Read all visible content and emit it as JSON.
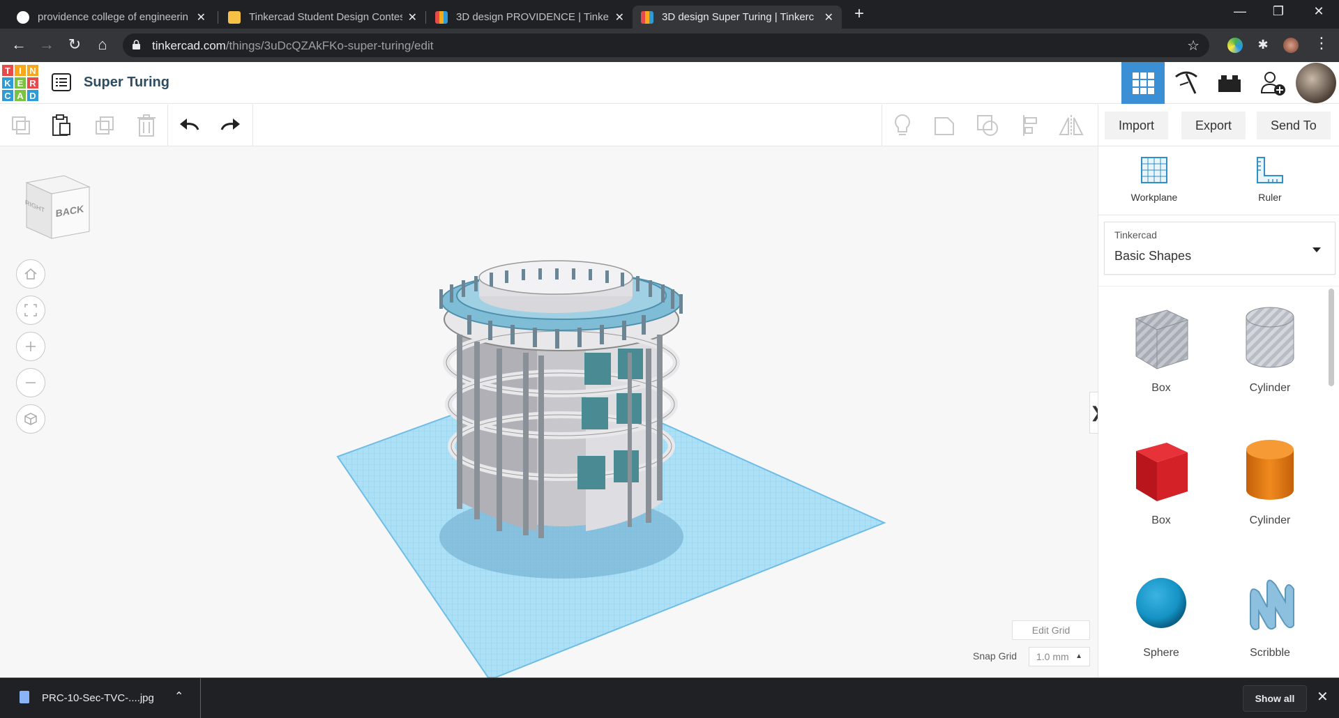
{
  "browser": {
    "tabs": [
      {
        "title": "providence college of engineerin",
        "active": false
      },
      {
        "title": "Tinkercad Student Design Contes",
        "active": false
      },
      {
        "title": "3D design PROVIDENCE | Tinkerc",
        "active": false
      },
      {
        "title": "3D design Super Turing | Tinkerc",
        "active": true
      }
    ],
    "url_host": "tinkercad.com",
    "url_path": "/things/3uDcQZAkFKo-super-turing/edit"
  },
  "app": {
    "logo_letters": [
      "T",
      "I",
      "N",
      "K",
      "E",
      "R",
      "C",
      "A",
      "D"
    ],
    "design_title": "Super Turing"
  },
  "toolbar": {
    "import_label": "Import",
    "export_label": "Export",
    "send_to_label": "Send To"
  },
  "workspace": {
    "viewcube_face": "BACK",
    "viewcube_side": "RIGHT",
    "edit_grid_label": "Edit Grid",
    "snap_grid_label": "Snap Grid",
    "snap_grid_value": "1.0 mm"
  },
  "panel": {
    "workplane_label": "Workplane",
    "ruler_label": "Ruler",
    "library_source": "Tinkercad",
    "library_name": "Basic Shapes",
    "shapes": [
      {
        "label": "Box",
        "color": "#b8bcc4"
      },
      {
        "label": "Cylinder",
        "color": "#c8ccd2"
      },
      {
        "label": "Box",
        "color": "#d42128"
      },
      {
        "label": "Cylinder",
        "color": "#e27b13"
      },
      {
        "label": "Sphere",
        "color": "#1593c4"
      },
      {
        "label": "Scribble",
        "color": "#7fb4d6"
      }
    ]
  },
  "downloads": {
    "file_name": "PRC-10-Sec-TVC-....jpg",
    "show_all_label": "Show all"
  },
  "colors": {
    "accent": "#3b8fd4",
    "grid": "#8fcfee",
    "chrome_dark": "#202124"
  }
}
